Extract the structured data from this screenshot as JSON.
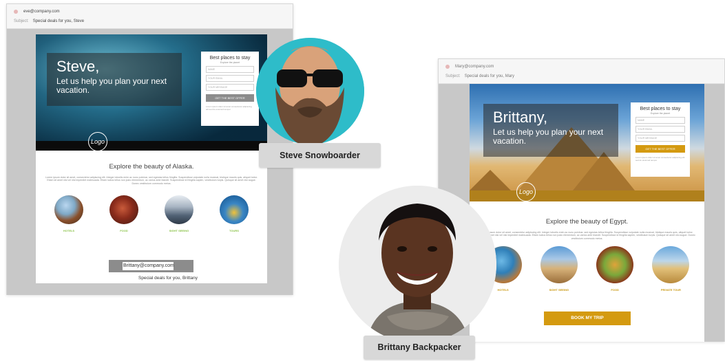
{
  "left_email": {
    "from": "eve@company.com",
    "subject_key": "Subject:",
    "subject": "Special deals for you, Steve",
    "greeting_name": "Steve,",
    "greeting_sub": "Let us help you plan your next vacation.",
    "form": {
      "title": "Best places to stay",
      "subtitle": "Explore the planet",
      "fields": [
        "NAME",
        "YOUR EMAIL",
        "YOUR MESSAGE"
      ],
      "button": "GET THE BEST OFFER",
      "note": "Lorem ipsum dolor sit amet consectetur adipiscing elit sed do eiusmod tempor"
    },
    "logo_text": "Logo",
    "explore": "Explore the beauty of Alaska.",
    "lorem": "Lorem ipsum dolor sit amet, consectetur adipiscing elit. Integer lobortis enim ac nunc pulvinar, sed egestas tellus fringilla. Suspendisse vulputate nulla musicat, tristique mauris quis, aliquet tortor. Etiam sit amet nisi vel nisi imperdiet malesuada. Etiam luctus tellus non justo elementum, ac varius ante blandit. Suspendisse id fringilla sapien, vestibulum turpis. Quisque sit amet nisi augue. Donec vestibulum commodo metus.",
    "categories": [
      {
        "label": "HOTELS",
        "color": "#8bc34a"
      },
      {
        "label": "FOOD",
        "color": "#8bc34a"
      },
      {
        "label": "SIGHT SEEING",
        "color": "#8bc34a"
      },
      {
        "label": "TOURS",
        "color": "#8bc34a"
      }
    ],
    "overlay_email": "Brittany@company.com",
    "overlay_subject": "Special deals for you, Brittany"
  },
  "right_email": {
    "from": "Mary@company.com",
    "subject_key": "Subject:",
    "subject": "Special deals for you, Mary",
    "greeting_name": "Brittany,",
    "greeting_sub": "Let us help you plan your next vacation.",
    "form": {
      "title": "Best places to stay",
      "subtitle": "Explore the planet",
      "fields": [
        "NAME",
        "YOUR EMAIL",
        "YOUR MESSAGE"
      ],
      "button": "GET THE BEST OFFER",
      "note": "Lorem ipsum dolor sit amet consectetur adipiscing elit sed do eiusmod tempor"
    },
    "logo_text": "Logo",
    "explore": "Explore the beauty of Egypt.",
    "lorem": "Lorem ipsum dolor sit amet, consectetur adipiscing elit. Integer lobortis enim ac nunc pulvinar, sed egestas tellus fringilla. Suspendisse vulputate nulla musicat, tristique mauris quis, aliquet tortor. Etiam sit amet nisi vel nisi imperdiet malesuada. Etiam luctus tellus non justo elementum, ac varius ante blandit. Suspendisse id fringilla sapien, vestibulum turpis. Quisque sit amet nisi augue. Donec vestibulum commodo metus.",
    "categories": [
      {
        "label": "HOTELS",
        "color": "#c8960c"
      },
      {
        "label": "SIGHT SEEING",
        "color": "#c8960c"
      },
      {
        "label": "FOOD",
        "color": "#c8960c"
      },
      {
        "label": "PRIVATE TOUR",
        "color": "#c8960c"
      }
    ],
    "cta": "BOOK MY TRIP"
  },
  "personas": {
    "steve": "Steve Snowboarder",
    "brittany": "Brittany Backpacker"
  },
  "colors": {
    "steve_accent": "#8c8c8c",
    "brittany_accent": "#d49a10",
    "steve_category": "#8bc34a",
    "brittany_category": "#c8960c",
    "persona_bg_steve": "#2ebcc9"
  }
}
